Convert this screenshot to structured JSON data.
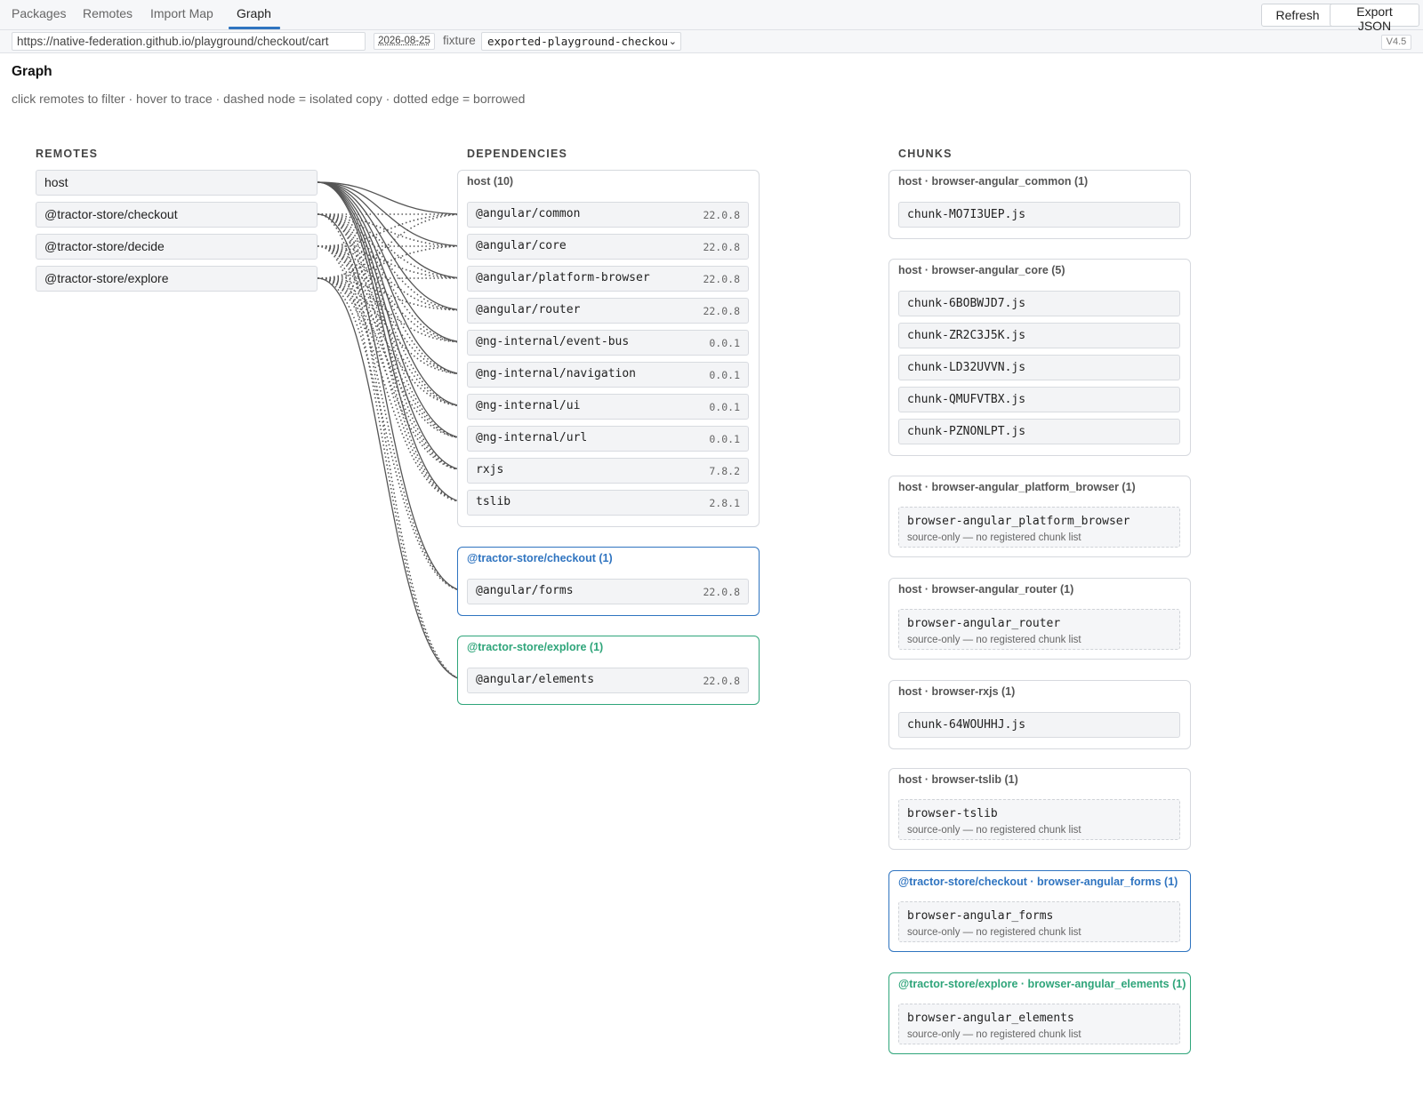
{
  "tabs": [
    {
      "label": "Packages",
      "active": false
    },
    {
      "label": "Remotes",
      "active": false
    },
    {
      "label": "Import Map",
      "active": false
    },
    {
      "label": "Graph",
      "active": true
    }
  ],
  "toolbar": {
    "refresh_label": "Refresh",
    "export_label": "Export JSON"
  },
  "subbar": {
    "url": "https://native-federation.github.io/playground/checkout/cart",
    "date": "2026-08-25",
    "fixture_label": "fixture",
    "fixture_value": "exported-playground-checkout",
    "version": "V4.5"
  },
  "page": {
    "title": "Graph",
    "hint": "click remotes to filter · hover to trace · dashed node = isolated copy · dotted edge = borrowed"
  },
  "columns": {
    "remotes": "REMOTES",
    "dependencies": "DEPENDENCIES",
    "chunks": "CHUNKS"
  },
  "colors": {
    "host": "#555555",
    "checkout": "#2f74c0",
    "explore": "#2fa57a",
    "edge": "#555555"
  },
  "remotes": [
    "host",
    "@tractor-store/checkout",
    "@tractor-store/decide",
    "@tractor-store/explore"
  ],
  "dep_groups": [
    {
      "title": "host (10)",
      "color": "host",
      "items": [
        {
          "name": "@angular/common",
          "version": "22.0.8"
        },
        {
          "name": "@angular/core",
          "version": "22.0.8"
        },
        {
          "name": "@angular/platform-browser",
          "version": "22.0.8"
        },
        {
          "name": "@angular/router",
          "version": "22.0.8"
        },
        {
          "name": "@ng-internal/event-bus",
          "version": "0.0.1"
        },
        {
          "name": "@ng-internal/navigation",
          "version": "0.0.1"
        },
        {
          "name": "@ng-internal/ui",
          "version": "0.0.1"
        },
        {
          "name": "@ng-internal/url",
          "version": "0.0.1"
        },
        {
          "name": "rxjs",
          "version": "7.8.2"
        },
        {
          "name": "tslib",
          "version": "2.8.1"
        }
      ]
    },
    {
      "title": "@tractor-store/checkout (1)",
      "color": "checkout",
      "items": [
        {
          "name": "@angular/forms",
          "version": "22.0.8"
        }
      ]
    },
    {
      "title": "@tractor-store/explore (1)",
      "color": "explore",
      "items": [
        {
          "name": "@angular/elements",
          "version": "22.0.8"
        }
      ]
    }
  ],
  "chunk_groups": [
    {
      "title": "host · browser-angular_common (1)",
      "color": "host",
      "items": [
        {
          "name": "chunk-MO7I3UEP.js"
        }
      ]
    },
    {
      "title": "host · browser-angular_core (5)",
      "color": "host",
      "items": [
        {
          "name": "chunk-6BOBWJD7.js"
        },
        {
          "name": "chunk-ZR2C3J5K.js"
        },
        {
          "name": "chunk-LD32UVVN.js"
        },
        {
          "name": "chunk-QMUFVTBX.js"
        },
        {
          "name": "chunk-PZNONLPT.js"
        }
      ]
    },
    {
      "title": "host · browser-angular_platform_browser (1)",
      "color": "host",
      "items": [
        {
          "name": "browser-angular_platform_browser",
          "note": "source-only — no registered chunk list"
        }
      ]
    },
    {
      "title": "host · browser-angular_router (1)",
      "color": "host",
      "items": [
        {
          "name": "browser-angular_router",
          "note": "source-only — no registered chunk list"
        }
      ]
    },
    {
      "title": "host · browser-rxjs (1)",
      "color": "host",
      "items": [
        {
          "name": "chunk-64WOUHHJ.js"
        }
      ]
    },
    {
      "title": "host · browser-tslib (1)",
      "color": "host",
      "items": [
        {
          "name": "browser-tslib",
          "note": "source-only — no registered chunk list"
        }
      ]
    },
    {
      "title": "@tractor-store/checkout · browser-angular_forms (1)",
      "color": "checkout",
      "items": [
        {
          "name": "browser-angular_forms",
          "note": "source-only — no registered chunk list"
        }
      ]
    },
    {
      "title": "@tractor-store/explore · browser-angular_elements (1)",
      "color": "explore",
      "items": [
        {
          "name": "browser-angular_elements",
          "note": "source-only — no registered chunk list"
        }
      ]
    }
  ]
}
